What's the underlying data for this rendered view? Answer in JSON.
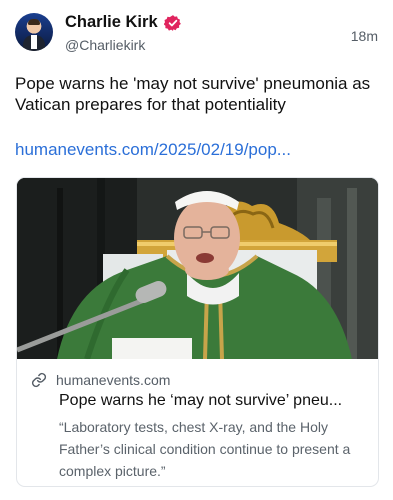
{
  "post": {
    "author_name": "Charlie Kirk",
    "author_handle": "@Charliekirk",
    "timestamp": "18m",
    "text": "Pope warns he 'may not survive' pneumonia as Vatican prepares for that potentiality",
    "link_text": "humanevents.com/2025/02/19/pop..."
  },
  "card": {
    "domain": "humanevents.com",
    "title": "Pope warns he ‘may not survive’ pneu...",
    "description": "“Laboratory tests, chest X-ray, and the Holy Father’s clinical condition continue to present a complex picture.”"
  },
  "colors": {
    "link": "#2b6fd8",
    "verified_badge": "#e0245e",
    "secondary_text": "#555d66"
  }
}
